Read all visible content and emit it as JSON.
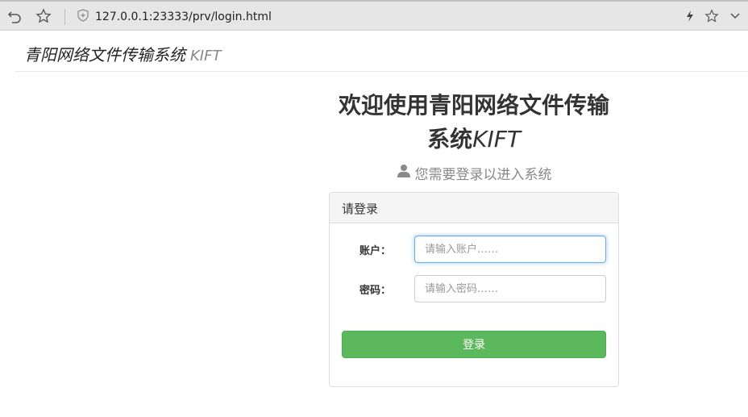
{
  "browser": {
    "url": "127.0.0.1:23333/prv/login.html"
  },
  "header": {
    "brand_main": "青阳网络文件传输系统",
    "brand_sub": "KIFT"
  },
  "hero": {
    "title_line1": "欢迎使用青阳网络文件传输",
    "title_line2": "系统",
    "title_kift": "KIFT",
    "subtitle": "您需要登录以进入系统"
  },
  "panel": {
    "heading": "请登录",
    "account_label": "账户：",
    "account_placeholder": "请输入账户……",
    "password_label": "密码：",
    "password_placeholder": "请输入密码……",
    "login_button": "登录"
  },
  "colors": {
    "accent_green": "#5cb85c",
    "focus_blue": "#66afe9"
  }
}
